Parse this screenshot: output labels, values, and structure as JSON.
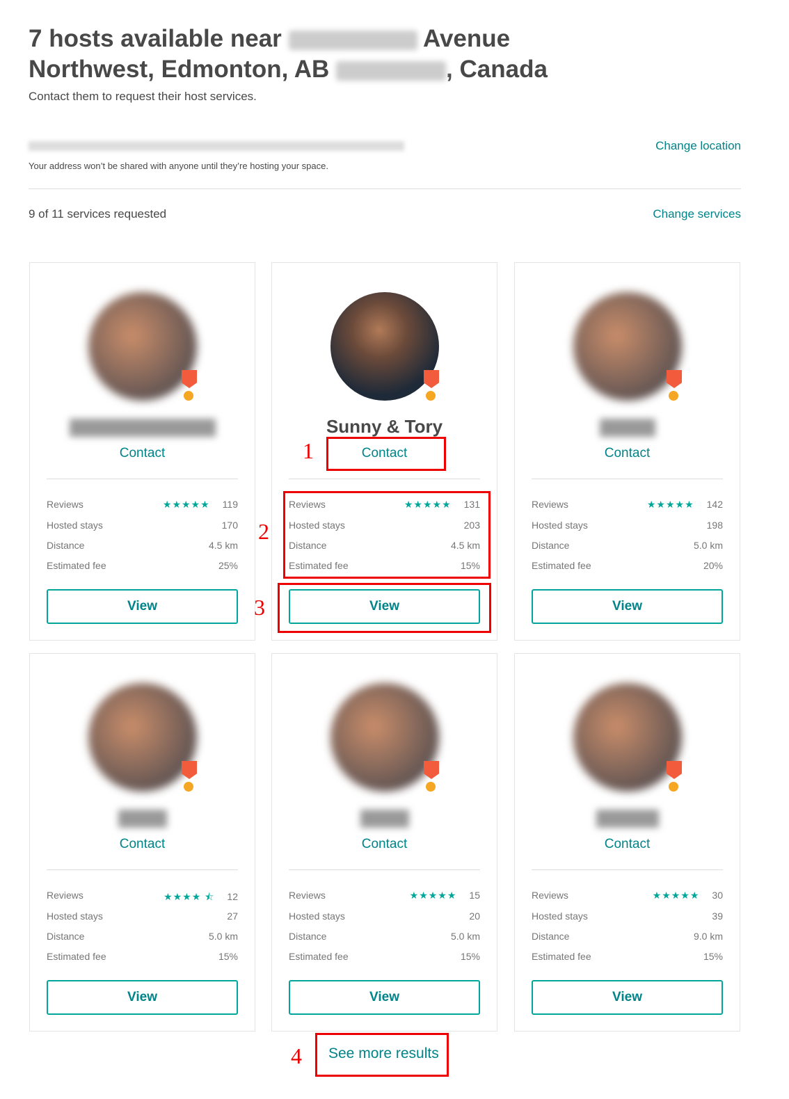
{
  "header": {
    "title_part1": "7 hosts available near",
    "title_part2": "Avenue",
    "title_part3": "Northwest, Edmonton, AB",
    "title_part4": ", Canada",
    "subtitle": "Contact them to request their host services."
  },
  "location": {
    "note": "Your address won’t be shared with anyone until they’re hosting your space.",
    "change_label": "Change location"
  },
  "services": {
    "status": "9 of 11 services requested",
    "change_label": "Change services"
  },
  "labels": {
    "reviews": "Reviews",
    "hosted": "Hosted stays",
    "distance": "Distance",
    "fee": "Estimated fee",
    "contact": "Contact",
    "view": "View"
  },
  "hosts": [
    {
      "name": "",
      "rating": 5,
      "stars": "★★★★★",
      "reviews": "119",
      "hosted": "170",
      "distance": "4.5 km",
      "fee": "25%"
    },
    {
      "name": "Sunny & Tory",
      "rating": 5,
      "stars": "★★★★★",
      "reviews": "131",
      "hosted": "203",
      "distance": "4.5 km",
      "fee": "15%"
    },
    {
      "name": "",
      "rating": 5,
      "stars": "★★★★★",
      "reviews": "142",
      "hosted": "198",
      "distance": "5.0 km",
      "fee": "20%"
    },
    {
      "name": "",
      "rating": 4.5,
      "stars": "★★★★ ⯪",
      "reviews": "12",
      "hosted": "27",
      "distance": "5.0 km",
      "fee": "15%"
    },
    {
      "name": "",
      "rating": 5,
      "stars": "★★★★★",
      "reviews": "15",
      "hosted": "20",
      "distance": "5.0 km",
      "fee": "15%"
    },
    {
      "name": "",
      "rating": 5,
      "stars": "★★★★★",
      "reviews": "30",
      "hosted": "39",
      "distance": "9.0 km",
      "fee": "15%"
    }
  ],
  "see_more": "See more results",
  "annotations": [
    "1",
    "2",
    "3",
    "4"
  ],
  "colors": {
    "accent": "#008489",
    "star": "#00a699",
    "annotation": "#e00000"
  }
}
